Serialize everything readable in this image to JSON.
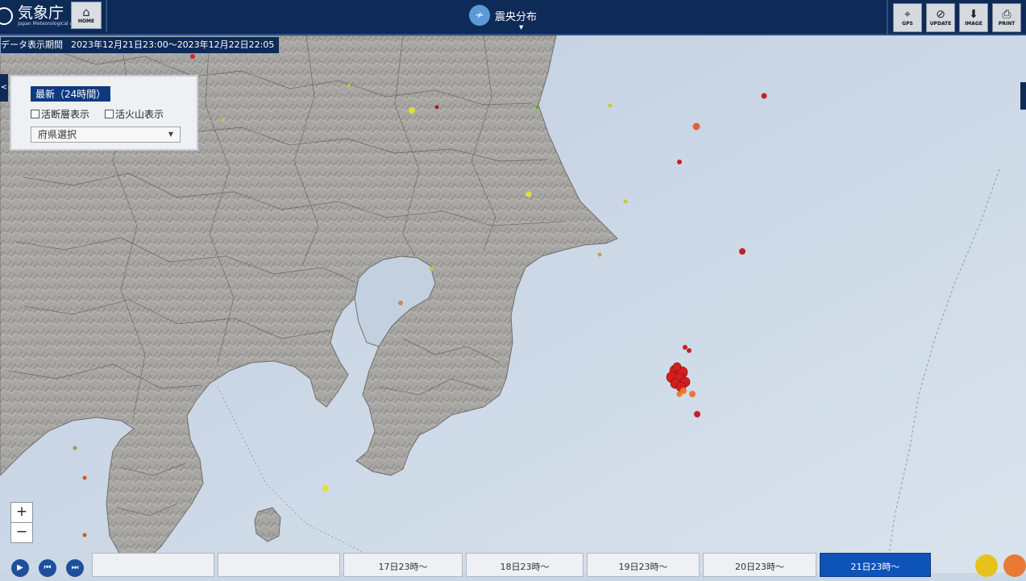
{
  "header": {
    "logo_title": "気象庁",
    "logo_subtitle": "Japan Meteorological Agency",
    "home_label": "HOME",
    "page_title": "震央分布",
    "tools": [
      {
        "label": "GPS",
        "icon": "gps-icon"
      },
      {
        "label": "UPDATE",
        "icon": "update-icon"
      },
      {
        "label": "IMAGE",
        "icon": "download-icon"
      },
      {
        "label": "PRINT",
        "icon": "print-icon"
      }
    ]
  },
  "period": {
    "label": "データ表示期間",
    "range": "2023年12月21日23:00～2023年12月22日22:05"
  },
  "panel": {
    "latest_label": "最新（24時間）",
    "fault_label": "活断層表示",
    "volcano_label": "活火山表示",
    "prefecture_select": "府県選択"
  },
  "zoom": {
    "in": "+",
    "out": "−"
  },
  "timeline": {
    "tabs": [
      "",
      "",
      "17日23時～",
      "18日23時～",
      "19日23時～",
      "20日23時～",
      "21日23時～"
    ],
    "active_index": 6
  },
  "colors": {
    "header_bg": "#0e2a57",
    "sea": "#c9d6e3",
    "land": "#a9a7a3",
    "quake_shallow": "#d41f1f",
    "quake_mid": "#e87a35",
    "quake_deep": "#c5c93a",
    "active_tab": "#0e53b8"
  }
}
